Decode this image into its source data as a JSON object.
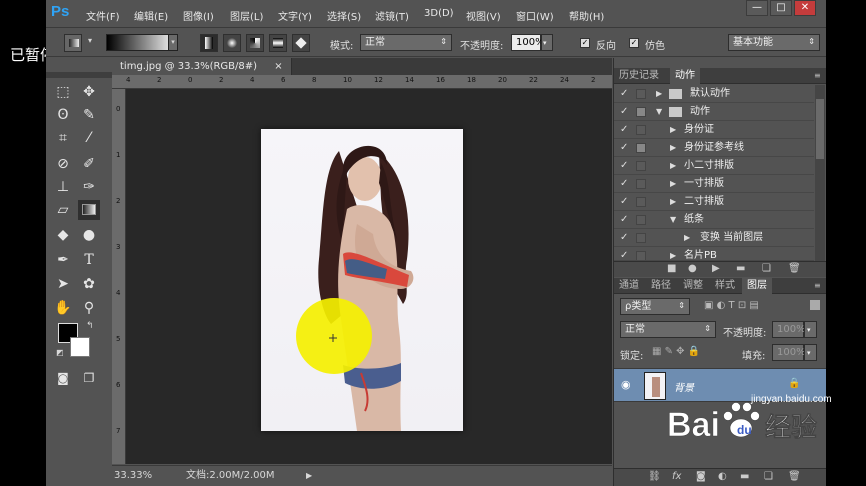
{
  "overlay": {
    "paused_label": "已暂停"
  },
  "app": {
    "logo": "Ps"
  },
  "menu": [
    "文件(F)",
    "编辑(E)",
    "图像(I)",
    "图层(L)",
    "文字(Y)",
    "选择(S)",
    "滤镜(T)",
    "3D(D)",
    "视图(V)",
    "窗口(W)",
    "帮助(H)"
  ],
  "window_buttons": [
    "—",
    "□",
    "✕"
  ],
  "options": {
    "mode_label": "模式:",
    "mode_value": "正常",
    "opacity_label": "不透明度:",
    "opacity_value": "100%",
    "reverse_label": "反向",
    "dither_label": "仿色",
    "workspace": "基本功能"
  },
  "document": {
    "tab_title": "timg.jpg @ 33.3%(RGB/8#)",
    "close_glyph": "×",
    "ruler_top": [
      "4",
      "2",
      "0",
      "2",
      "4",
      "6",
      "8",
      "10",
      "12",
      "14",
      "16",
      "18",
      "20",
      "22",
      "24",
      "2"
    ],
    "ruler_left": [
      "0",
      "1",
      "2",
      "3",
      "4",
      "5",
      "6",
      "7"
    ]
  },
  "status": {
    "zoom": "33.33%",
    "doc_info": "文档:2.00M/2.00M"
  },
  "actions_panel": {
    "tabs": [
      "历史记录",
      "动作"
    ],
    "rows": [
      {
        "name": "默认动作",
        "type": "folder",
        "expanded": false
      },
      {
        "name": "动作",
        "type": "folder",
        "expanded": true
      },
      {
        "name": "身份证",
        "type": "action"
      },
      {
        "name": "身份证参考线",
        "type": "action"
      },
      {
        "name": "小二寸排版",
        "type": "action"
      },
      {
        "name": "一寸排版",
        "type": "action"
      },
      {
        "name": "二寸排版",
        "type": "action"
      },
      {
        "name": "纸条",
        "type": "action",
        "expanded": true
      },
      {
        "name": "变换 当前图层",
        "type": "step"
      },
      {
        "name": "名片PB",
        "type": "action"
      }
    ]
  },
  "layers_panel": {
    "tabs": [
      "通道",
      "路径",
      "调整",
      "样式",
      "图层"
    ],
    "filter_label": "ρ类型",
    "blend_mode": "正常",
    "opacity_label": "不透明度:",
    "opacity_value": "100%",
    "lock_label": "锁定:",
    "fill_label": "填充:",
    "fill_value": "100%",
    "layer_name": "背景",
    "footer_icons": [
      "link-icon",
      "fx-icon",
      "mask-icon",
      "adjustment-icon",
      "folder-icon",
      "new-layer-icon",
      "trash-icon"
    ]
  },
  "watermark": {
    "brand": "Bai",
    "brand2": "经验",
    "url": "jingyan.baidu.com"
  },
  "colors": {
    "accent_blue": "#2fa3f5",
    "layer_selected": "#6e8db1",
    "highlight_yellow": "#f5f000"
  }
}
